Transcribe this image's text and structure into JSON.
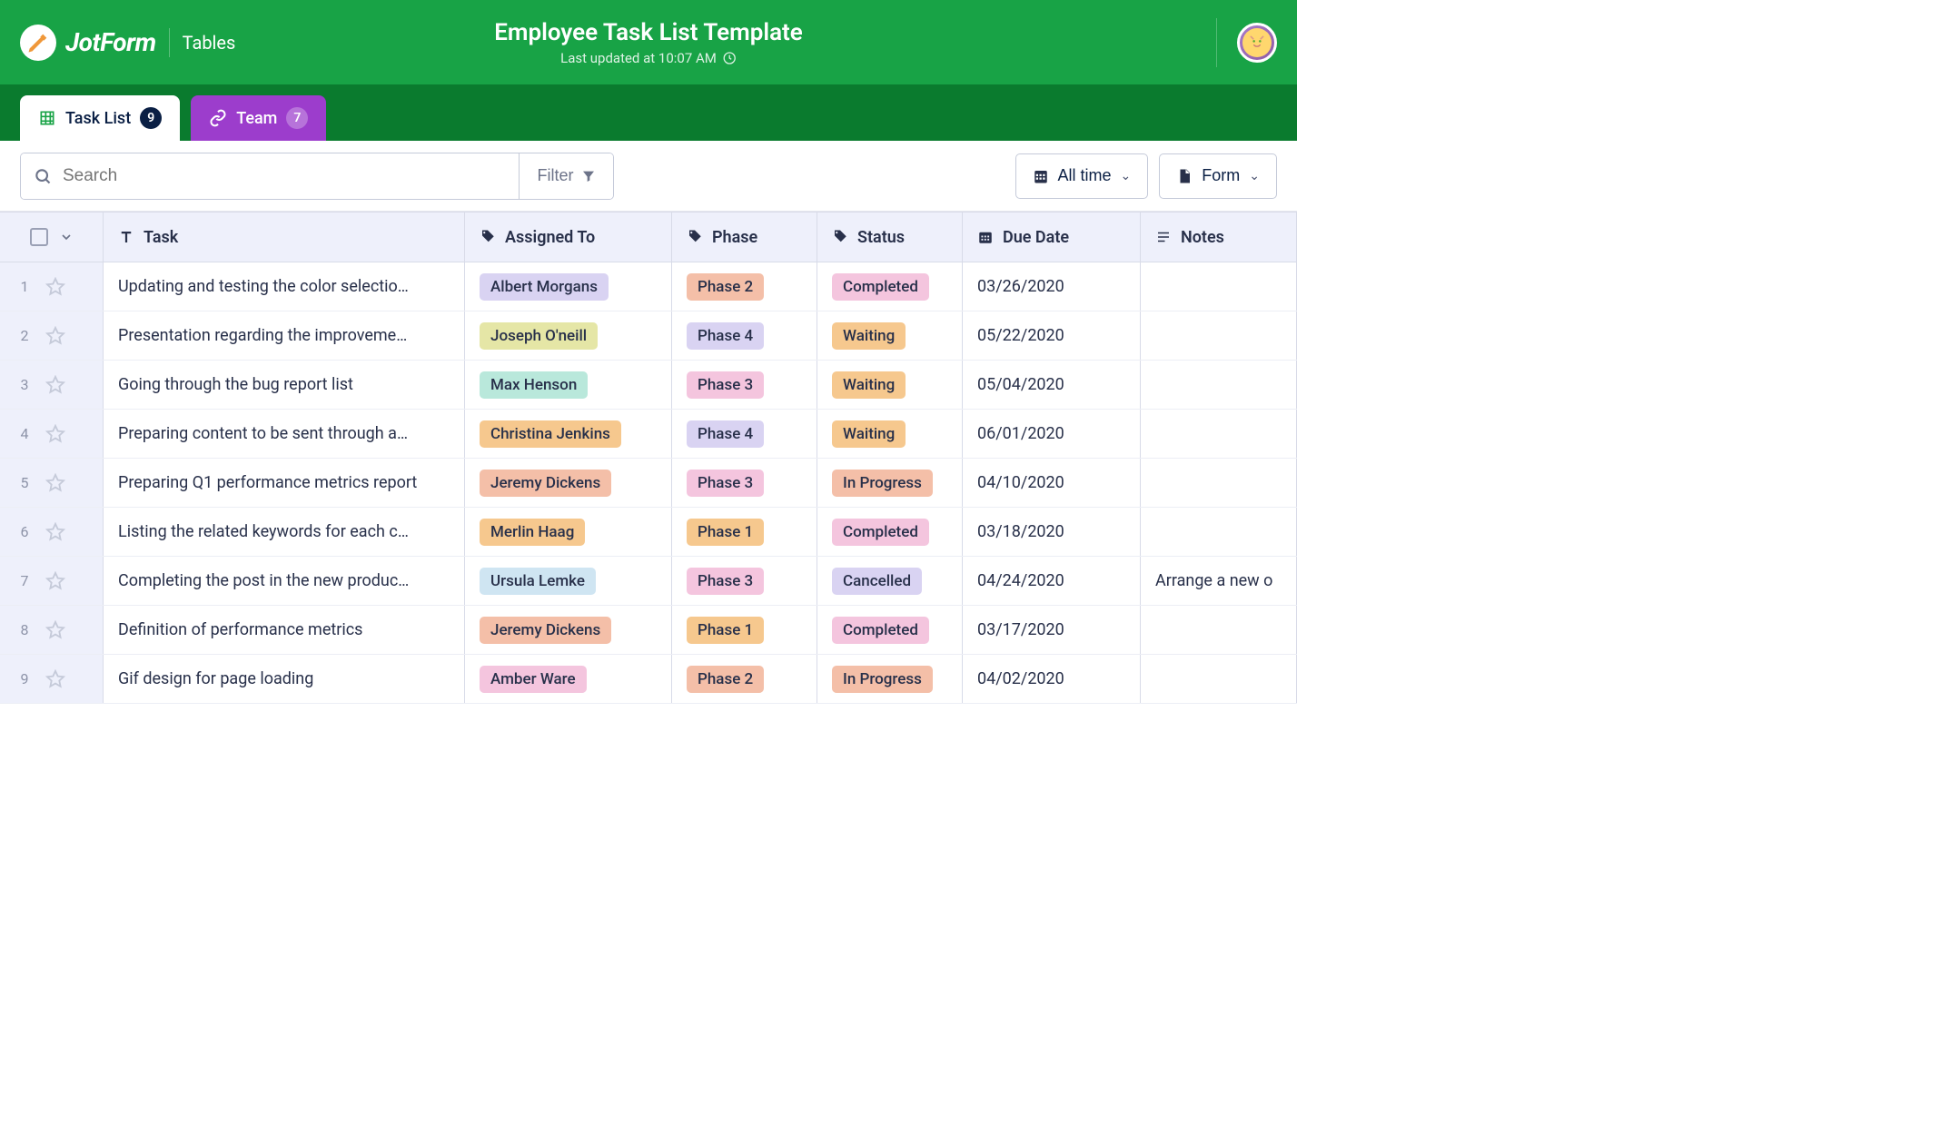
{
  "header": {
    "brand": "JotForm",
    "section": "Tables",
    "title": "Employee Task List Template",
    "lastUpdated": "Last updated at 10:07 AM"
  },
  "tabs": {
    "taskList": {
      "label": "Task List",
      "count": "9"
    },
    "team": {
      "label": "Team",
      "count": "7"
    }
  },
  "toolbar": {
    "searchPlaceholder": "Search",
    "filterLabel": "Filter",
    "allTimeLabel": "All time",
    "formLabel": "Form"
  },
  "columns": {
    "task": "Task",
    "assignedTo": "Assigned To",
    "phase": "Phase",
    "status": "Status",
    "dueDate": "Due Date",
    "notes": "Notes"
  },
  "colors": {
    "assignee": {
      "Albert Morgans": "#d9d3f2",
      "Joseph O'neill": "#e5e6a6",
      "Max Henson": "#b9e8db",
      "Christina Jenkins": "#f6c88e",
      "Jeremy Dickens": "#f4bfa8",
      "Merlin Haag": "#f6c88e",
      "Ursula Lemke": "#cfe5f2",
      "Amber Ware": "#f4c5de"
    },
    "phase": {
      "Phase 1": "#f6c88e",
      "Phase 2": "#f4bfa8",
      "Phase 3": "#f4c5de",
      "Phase 4": "#d9d3f2"
    },
    "status": {
      "Completed": "#f4c5de",
      "Waiting": "#f6c88e",
      "In Progress": "#f4bfa8",
      "Cancelled": "#d9d3f2"
    }
  },
  "rows": [
    {
      "n": "1",
      "task": "Updating and testing the color selectio…",
      "assignee": "Albert Morgans",
      "phase": "Phase 2",
      "status": "Completed",
      "date": "03/26/2020",
      "notes": ""
    },
    {
      "n": "2",
      "task": "Presentation regarding the improveme…",
      "assignee": "Joseph O'neill",
      "phase": "Phase 4",
      "status": "Waiting",
      "date": "05/22/2020",
      "notes": ""
    },
    {
      "n": "3",
      "task": "Going through the bug report list",
      "assignee": "Max Henson",
      "phase": "Phase 3",
      "status": "Waiting",
      "date": "05/04/2020",
      "notes": ""
    },
    {
      "n": "4",
      "task": "Preparing content to be sent through a…",
      "assignee": "Christina Jenkins",
      "phase": "Phase 4",
      "status": "Waiting",
      "date": "06/01/2020",
      "notes": ""
    },
    {
      "n": "5",
      "task": "Preparing Q1 performance metrics report",
      "assignee": "Jeremy Dickens",
      "phase": "Phase 3",
      "status": "In Progress",
      "date": "04/10/2020",
      "notes": ""
    },
    {
      "n": "6",
      "task": "Listing the related keywords for each c…",
      "assignee": "Merlin Haag",
      "phase": "Phase 1",
      "status": "Completed",
      "date": "03/18/2020",
      "notes": ""
    },
    {
      "n": "7",
      "task": "Completing the post in the new produc…",
      "assignee": "Ursula Lemke",
      "phase": "Phase 3",
      "status": "Cancelled",
      "date": "04/24/2020",
      "notes": "Arrange a new o"
    },
    {
      "n": "8",
      "task": "Definition of performance metrics",
      "assignee": "Jeremy Dickens",
      "phase": "Phase 1",
      "status": "Completed",
      "date": "03/17/2020",
      "notes": ""
    },
    {
      "n": "9",
      "task": "Gif design for page loading",
      "assignee": "Amber Ware",
      "phase": "Phase 2",
      "status": "In Progress",
      "date": "04/02/2020",
      "notes": ""
    }
  ]
}
